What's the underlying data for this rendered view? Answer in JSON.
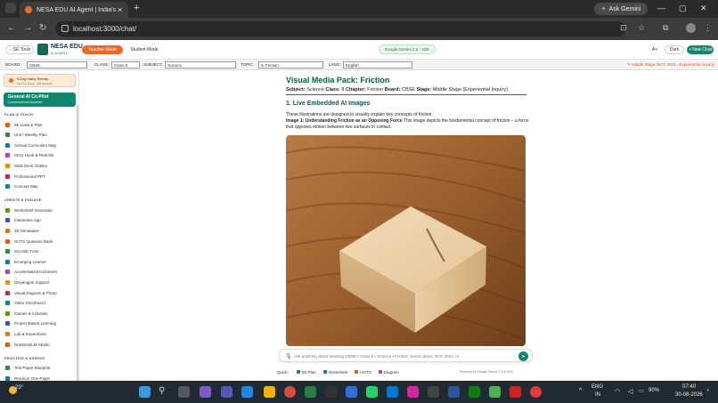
{
  "browser": {
    "tab_title": "NESA EDU AI Agent | India's Sm",
    "url": "localhost:3000/chat/",
    "gemini_label": "Ask Gemini"
  },
  "header": {
    "back_label": "SE Tools",
    "brand_name": "NESA EDU",
    "brand_sub": "AI AGENT",
    "teacher_mode": "Teacher Mode",
    "student_mode": "Student Mode",
    "model_label": "Google Gemini 2.5 · ADK",
    "font_size": "A+",
    "dark_label": "Dark",
    "new_chat": "+ New Chat"
  },
  "filters": {
    "board_label": "BOARD:",
    "board_value": "CBSE",
    "class_label": "CLASS:",
    "class_value": "Class 8",
    "subject_label": "SUBJECT:",
    "subject_value": "Science",
    "topic_label": "TOPIC:",
    "topic_value": "8. Friction",
    "lang_label": "LANG:",
    "lang_value": "English",
    "stage_note": "Middle Stage (NCF 2023 · Experiential Inquiry)"
  },
  "sidebar": {
    "streak_title": "5-Day Daily Streak",
    "streak_sub": "14.2 hrs saved · 420 students",
    "copilot_title": "General AI Co-Pilot",
    "copilot_sub": "Conversational Assistant",
    "sections": [
      {
        "title": "PLAN & TEACH",
        "items": [
          "5E Lesson Plan",
          "Unit / Weekly Plan",
          "Annual Curriculum Map",
          "Story Hook & Real-life",
          "Slide Deck Outline",
          "Professional PPT",
          "Concept Map"
        ]
      },
      {
        "title": "CREATE & ENGAGE",
        "items": [
          "Worksheet Generator",
          "Interactive App",
          "3D Simulation",
          "HOTS Question Bank",
          "Socratic Tutor",
          "Emerging Learner",
          "Accelerated Enrichment",
          "Divyangjan Support",
          "Visual Diagram & Photo",
          "Video Storyboard",
          "Games & Activities",
          "Project-Based Learning",
          "Lab & Experiment",
          "NotebookLM Studio"
        ]
      },
      {
        "title": "PRACTICE & ASSESS",
        "items": [
          "Test Paper Blueprint",
          "Revision One-Pager"
        ]
      }
    ]
  },
  "content": {
    "title": "Visual Media Pack: Friction",
    "meta": {
      "subject_label": "Subject:",
      "subject": "Science",
      "class_label": "Class:",
      "class": "8",
      "chapter_label": "Chapter:",
      "chapter": "Friction",
      "board_label": "Board:",
      "board": "CBSE",
      "stage_label": "Stage:",
      "stage": "Middle Stage (Experiential Inquiry)"
    },
    "section_heading": "1. Live Embedded AI Images",
    "intro": "These illustrations are designed to visually explain key concepts of friction.",
    "image_label": "Image 1: Understanding Friction as an Opposing Force",
    "image_desc": "This image depicts the fundamental concept of friction – a force that opposes motion between two surfaces in contact."
  },
  "chat": {
    "placeholder": "Ask anything about teaching CBSE • Class 8 • Science • Friction, lesson plans, NCF 2023, or",
    "quick_label": "Quick:",
    "quick_items": [
      "5E Plan",
      "Worksheet",
      "HOTS",
      "Diagram"
    ],
    "powered_by": "Powered by Google Gemini 2.5 & ADK"
  },
  "taskbar": {
    "weather": "23°",
    "lang": "ENG",
    "region": "IN",
    "battery": "90%",
    "time": "07:40",
    "date": "30-08-2026"
  }
}
